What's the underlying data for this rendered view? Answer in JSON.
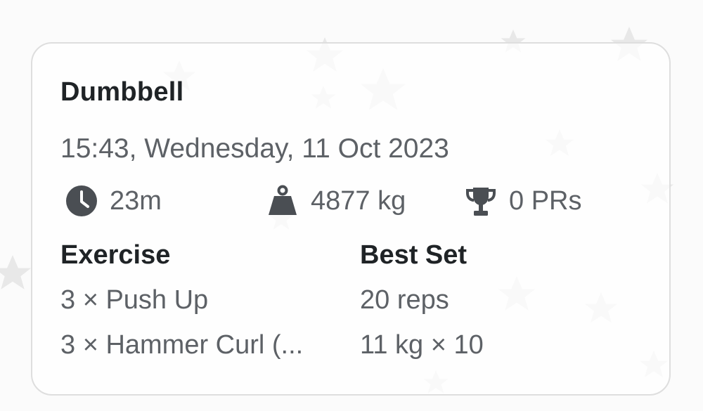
{
  "workout": {
    "title": "Dumbbell",
    "datetime": "15:43, Wednesday, 11 Oct 2023"
  },
  "stats": {
    "duration": {
      "icon": "clock-icon",
      "value": "23m"
    },
    "volume": {
      "icon": "weight-icon",
      "value": "4877 kg"
    },
    "prs": {
      "icon": "trophy-icon",
      "value": "0 PRs"
    }
  },
  "table": {
    "headers": {
      "exercise": "Exercise",
      "best_set": "Best Set"
    },
    "rows": [
      {
        "exercise": "3 × Push Up",
        "best_set": "20 reps"
      },
      {
        "exercise": "3 × Hammer Curl (...",
        "best_set": "11 kg × 10"
      }
    ]
  },
  "colors": {
    "title": "#1f2326",
    "secondary_text": "#5d6166",
    "icon": "#4a4e53",
    "card_border": "#dedede",
    "background_stars": "#e6e6e6"
  }
}
